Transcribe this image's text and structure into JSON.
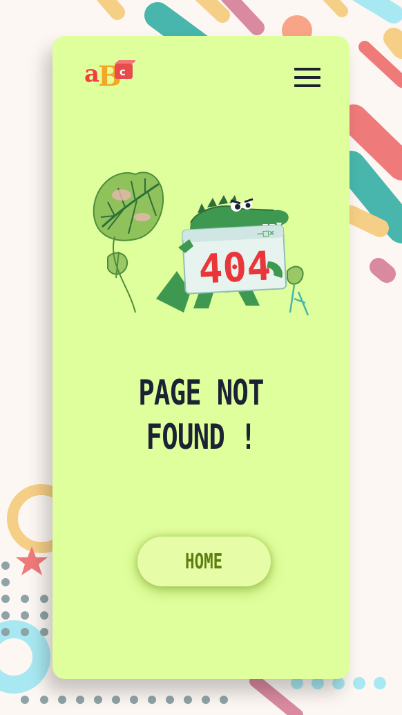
{
  "header": {
    "logo_text": "abc",
    "menu_icon": "hamburger-menu-icon"
  },
  "illustration": {
    "badge_text": "404",
    "icon": "crocodile-404-illustration"
  },
  "main": {
    "title_line1": "PAGE NOT",
    "title_line2": "FOUND !"
  },
  "actions": {
    "home_label": "HOME"
  },
  "colors": {
    "card_bg": "#dffe9c",
    "text_dark": "#1b2234",
    "button_text": "#5f7e12",
    "badge_red": "#e8363a"
  }
}
